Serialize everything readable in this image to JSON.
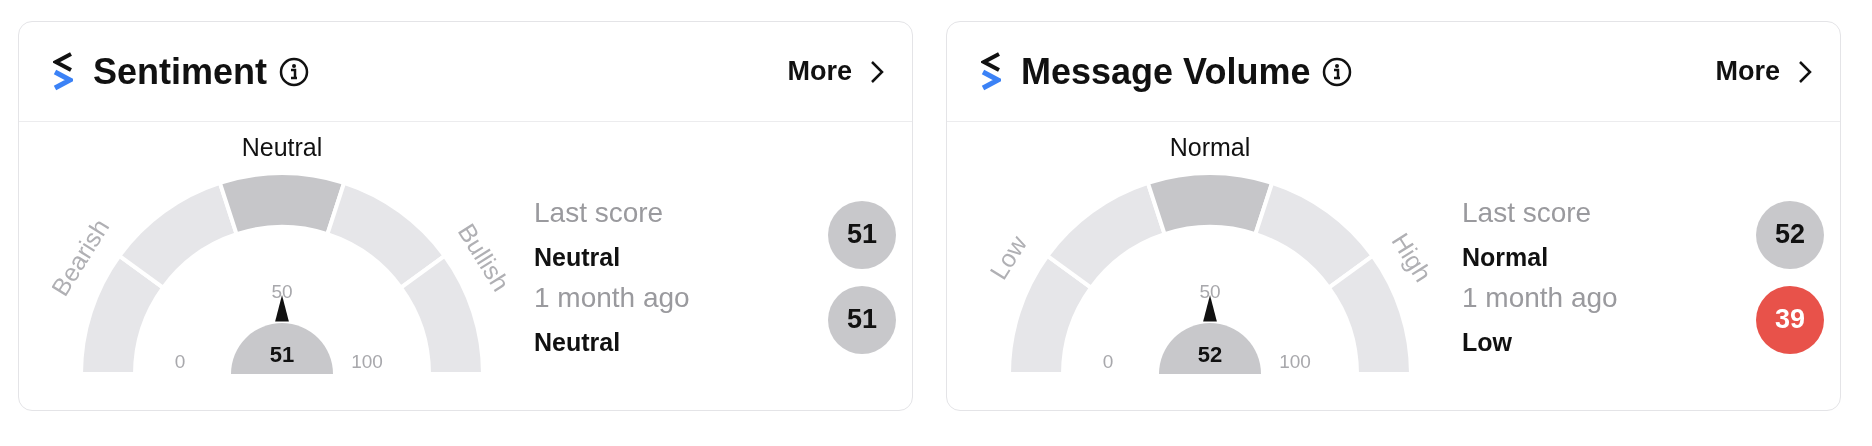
{
  "cards": [
    {
      "title": "Sentiment",
      "more": "More",
      "gauge": {
        "top_label": "Neutral",
        "left_label": "Bearish",
        "right_label": "Bullish",
        "min": "0",
        "mid": "50",
        "max": "100",
        "value": "51"
      },
      "scores": [
        {
          "label": "Last score",
          "value_label": "Neutral",
          "score": "51",
          "color": "#c8c8cb"
        },
        {
          "label": "1 month ago",
          "value_label": "Neutral",
          "score": "51",
          "color": "#c8c8cb"
        }
      ]
    },
    {
      "title": "Message Volume",
      "more": "More",
      "gauge": {
        "top_label": "Normal",
        "left_label": "Low",
        "right_label": "High",
        "min": "0",
        "mid": "50",
        "max": "100",
        "value": "52"
      },
      "scores": [
        {
          "label": "Last score",
          "value_label": "Normal",
          "score": "52",
          "color": "#c8c8cb"
        },
        {
          "label": "1 month ago",
          "value_label": "Low",
          "score": "39",
          "color": "#e8524a"
        }
      ]
    }
  ]
}
